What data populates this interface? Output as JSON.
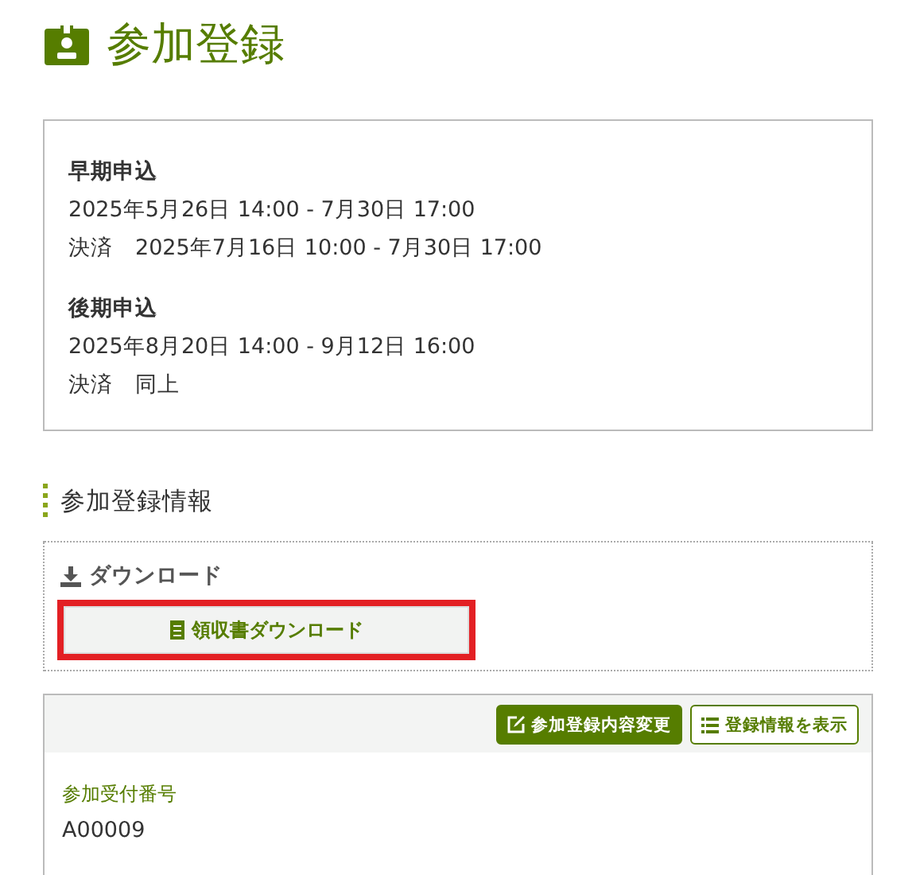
{
  "page_title": "参加登録",
  "periods": [
    {
      "heading": "早期申込",
      "lines": [
        "2025年5月26日 14:00 - 7月30日 17:00",
        "決済　2025年7月16日 10:00 - 7月30日 17:00"
      ]
    },
    {
      "heading": "後期申込",
      "lines": [
        "2025年8月20日 14:00 - 9月12日 16:00",
        "決済　同上"
      ]
    }
  ],
  "section_title": "参加登録情報",
  "download": {
    "heading": "ダウンロード",
    "button": {
      "label": "領収書ダウンロード",
      "highlighted": true
    }
  },
  "toolbar": [
    {
      "label": "参加登録内容変更",
      "kind": "primary"
    },
    {
      "label": "登録情報を表示",
      "kind": "outline"
    }
  ],
  "fields": [
    {
      "label": "参加受付番号",
      "value": "A00009"
    }
  ]
}
